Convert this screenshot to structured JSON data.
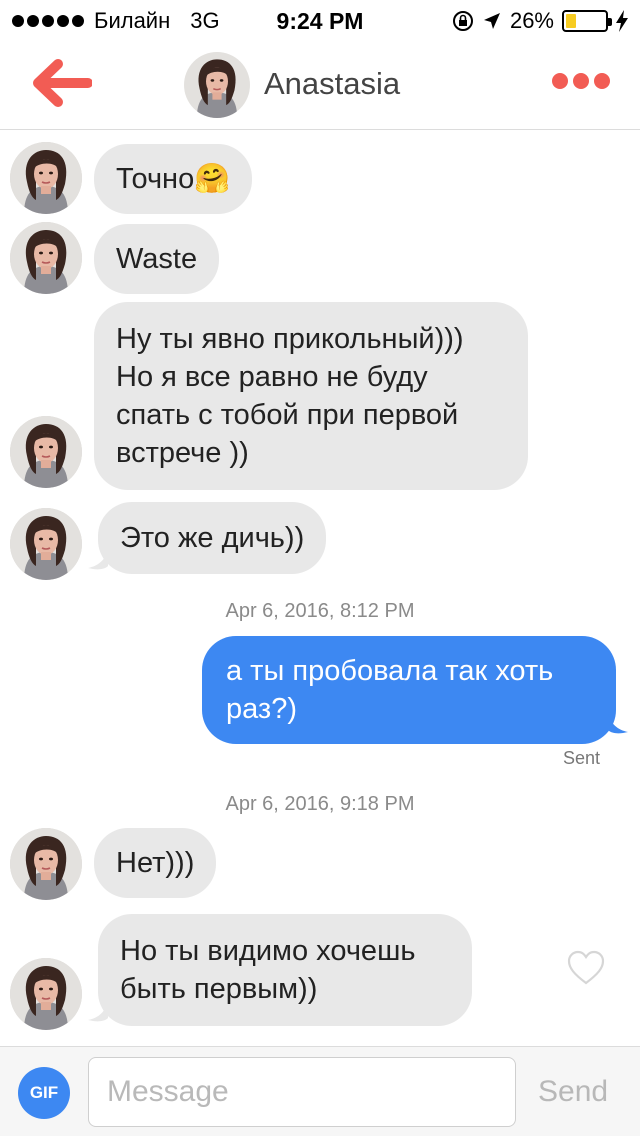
{
  "status_bar": {
    "carrier": "Билайн",
    "network": "3G",
    "time": "9:24 PM",
    "battery_percent": "26%",
    "battery_level": 0.26
  },
  "header": {
    "contact_name": "Anastasia",
    "accent_color": "#f25c54"
  },
  "messages": [
    {
      "direction": "incoming",
      "text": "Точно🤗"
    },
    {
      "direction": "incoming",
      "text": "Waste"
    },
    {
      "direction": "incoming",
      "text": "Ну ты явно прикольный)))\nНо я все равно не буду\nспать с тобой при первой\nвстрече ))"
    },
    {
      "direction": "incoming",
      "text": "Это же дичь))"
    },
    {
      "direction": "outgoing",
      "text": "а ты пробовала так хоть\nраз?)",
      "status": "Sent"
    },
    {
      "direction": "incoming",
      "text": "Нет)))"
    },
    {
      "direction": "incoming",
      "text": "Но ты видимо хочешь\nбыть первым))"
    }
  ],
  "timestamps": [
    "Apr 6, 2016, 8:12 PM",
    "Apr 6, 2016, 9:18 PM"
  ],
  "composer": {
    "gif_label": "GIF",
    "placeholder": "Message",
    "send_label": "Send"
  },
  "colors": {
    "outgoing_bubble": "#3d88f2",
    "incoming_bubble": "#e8e8e8"
  }
}
